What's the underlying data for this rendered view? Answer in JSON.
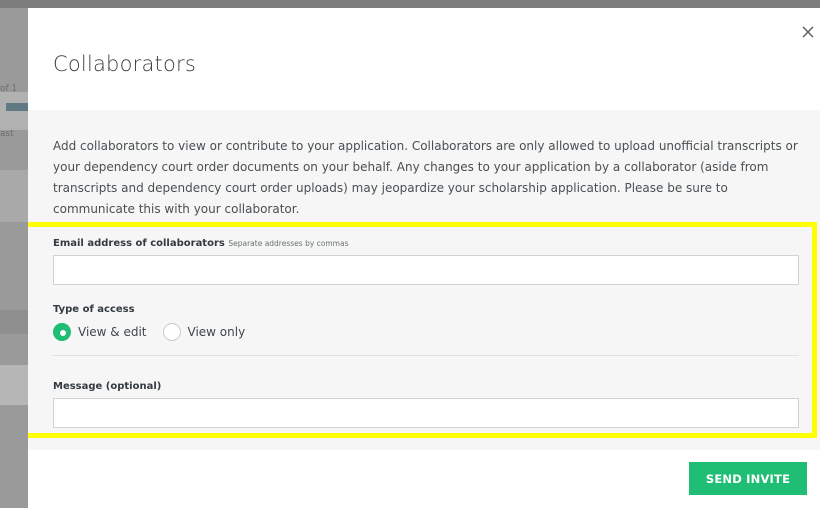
{
  "background": {
    "fragments": [
      "of 1",
      "ast"
    ]
  },
  "modal": {
    "title": "Collaborators",
    "close_icon": "close-icon",
    "intro": "Add collaborators to view or contribute to your application. Collaborators are only allowed to upload unofficial transcripts or your dependency court order documents on your behalf. Any changes to your application by a collaborator (aside from transcripts and dependency court order uploads) may jeopardize your scholarship application. Please be sure to communicate this with your collaborator.",
    "email": {
      "label": "Email address of collaborators",
      "hint": "Separate addresses by commas",
      "value": ""
    },
    "access": {
      "label": "Type of access",
      "options": [
        {
          "label": "View & edit",
          "selected": true
        },
        {
          "label": "View only",
          "selected": false
        }
      ]
    },
    "message": {
      "label": "Message (optional)",
      "value": ""
    },
    "send_label": "SEND INVITE"
  },
  "colors": {
    "accent": "#1fbe74",
    "highlight": "#ffff00"
  }
}
